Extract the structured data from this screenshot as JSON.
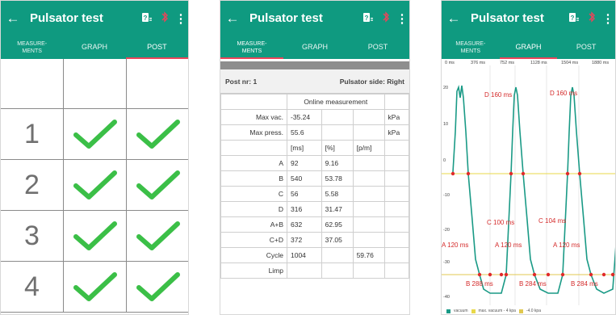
{
  "app": {
    "title": "Pulsator test",
    "back_glyph": "←",
    "help_icon": "help-battery-icon",
    "bluetooth_icon": "bluetooth-off-icon",
    "more_glyph": "⋮"
  },
  "tabs": [
    {
      "label": "MEASURE-\nMENTS"
    },
    {
      "label": "GRAPH"
    },
    {
      "label": "POST"
    }
  ],
  "post_grid": {
    "rows": [
      {
        "num": ""
      },
      {
        "num": "1"
      },
      {
        "num": "2"
      },
      {
        "num": "3"
      },
      {
        "num": "4"
      }
    ]
  },
  "measurements": {
    "post_label": "Post nr: 1",
    "side_label": "Pulsator side: Right",
    "online_header": "Online measurement",
    "rows": [
      {
        "label": "Max vac.",
        "v1": "-35.24",
        "v2": "",
        "v3": "",
        "unit": "kPa"
      },
      {
        "label": "Max press.",
        "v1": "55.6",
        "v2": "",
        "v3": "",
        "unit": "kPa"
      },
      {
        "label": "",
        "v1": "[ms]",
        "v2": "[%]",
        "v3": "[p/m]",
        "unit": ""
      },
      {
        "label": "A",
        "v1": "92",
        "v2": "9.16",
        "v3": "",
        "unit": ""
      },
      {
        "label": "B",
        "v1": "540",
        "v2": "53.78",
        "v3": "",
        "unit": ""
      },
      {
        "label": "C",
        "v1": "56",
        "v2": "5.58",
        "v3": "",
        "unit": ""
      },
      {
        "label": "D",
        "v1": "316",
        "v2": "31.47",
        "v3": "",
        "unit": ""
      },
      {
        "label": "A+B",
        "v1": "632",
        "v2": "62.95",
        "v3": "",
        "unit": ""
      },
      {
        "label": "C+D",
        "v1": "372",
        "v2": "37.05",
        "v3": "",
        "unit": ""
      },
      {
        "label": "Cycle",
        "v1": "1004",
        "v2": "",
        "v3": "59.76",
        "unit": ""
      },
      {
        "label": "Limp",
        "v1": "",
        "v2": "",
        "v3": "",
        "unit": ""
      }
    ]
  },
  "graph": {
    "x_ticks": [
      "0 ms",
      "376 ms",
      "752 ms",
      "1128 ms",
      "1504 ms",
      "1880 ms"
    ],
    "y_ticks": [
      "20",
      "10",
      "0",
      "-10",
      "-20",
      "-30",
      "-40"
    ],
    "annotations": [
      "D 160 ms",
      "D 160 ms",
      "C 100 ms",
      "C 104 ms",
      "A 120 ms",
      "A 120 ms",
      "A 120 ms",
      "B 288 ms",
      "B 284 ms",
      "B 284 ms"
    ],
    "legend": [
      "vacuum",
      "max. vacuum - 4 kpa",
      "-4.0 kpa"
    ],
    "colors": {
      "vacuum": "#1a9a86",
      "max_vac": "#e8d84a",
      "minus4": "#e0c850",
      "marker": "#e02a2a"
    }
  },
  "colors": {
    "accent": "#0f9a80",
    "check": "#3bbf47",
    "indicator": "#e8455a"
  }
}
